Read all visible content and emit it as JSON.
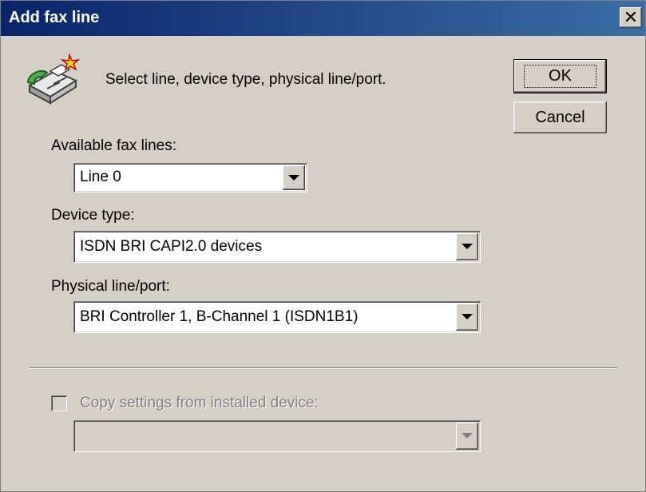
{
  "dialog": {
    "title": "Add fax line",
    "close_label": "✕",
    "message": "Select line, device type, physical line/port.",
    "ok_label": "OK",
    "cancel_label": "Cancel",
    "fax_lines": {
      "label": "Available fax lines:",
      "value": "Line 0"
    },
    "device_type": {
      "label": "Device type:",
      "value": "ISDN BRI CAPI2.0 devices"
    },
    "physical_port": {
      "label": "Physical line/port:",
      "value": "BRI Controller 1, B-Channel 1 (ISDN1B1)"
    },
    "copy_settings": {
      "label": "Copy settings from installed device:",
      "checked": false,
      "enabled": false,
      "value": ""
    }
  },
  "icons": {
    "fax": "fax-machine-icon",
    "dropdown": "chevron-down-icon"
  }
}
